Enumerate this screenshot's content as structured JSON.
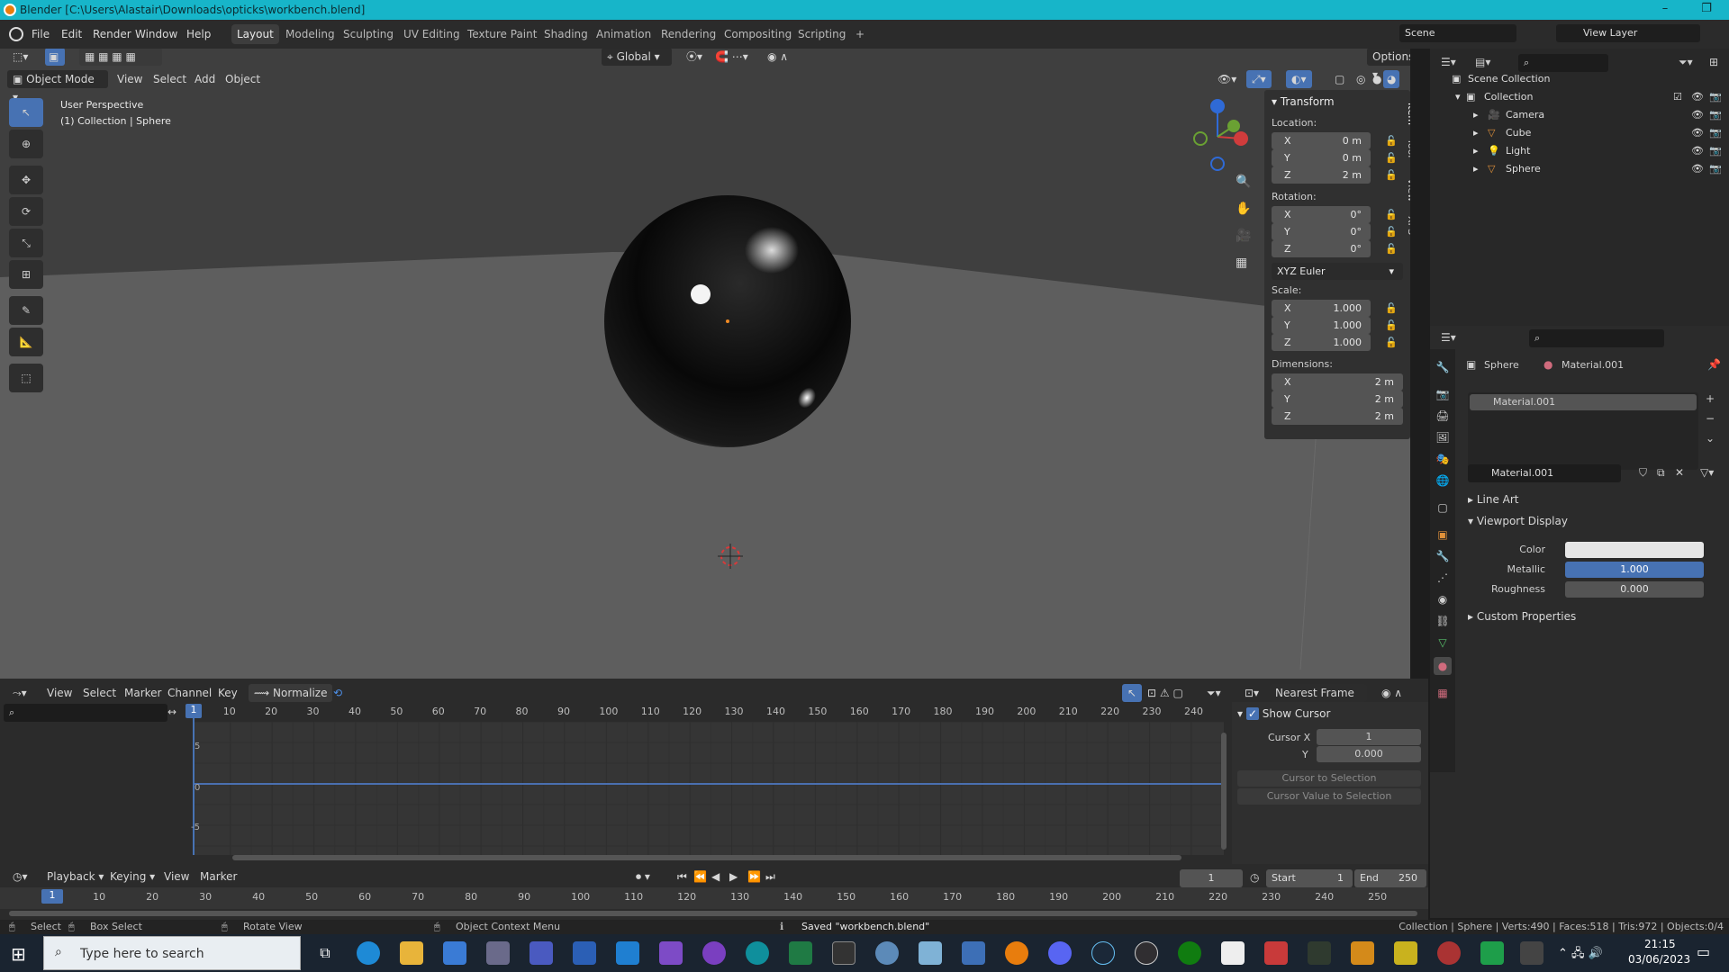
{
  "window": {
    "title": "Blender [C:\\Users\\Alastair\\Downloads\\opticks\\workbench.blend]"
  },
  "menu": {
    "items": [
      "File",
      "Edit",
      "Render",
      "Window",
      "Help"
    ]
  },
  "workspaces": [
    "Layout",
    "Modeling",
    "Sculpting",
    "UV Editing",
    "Texture Paint",
    "Shading",
    "Animation",
    "Rendering",
    "Compositing",
    "Scripting",
    "+"
  ],
  "scene": {
    "name": "Scene",
    "view_layer": "View Layer"
  },
  "viewport": {
    "transform_orientation": "Global",
    "mode": "Object Mode",
    "menus": [
      "View",
      "Select",
      "Add",
      "Object"
    ],
    "options_label": "Options",
    "perspective": "User Perspective",
    "collection_info": "(1) Collection | Sphere"
  },
  "npanel": {
    "title": "Transform",
    "tabs": [
      "Item",
      "Tool",
      "View",
      "XPS"
    ],
    "location_label": "Location:",
    "location": [
      {
        "axis": "X",
        "value": "0 m"
      },
      {
        "axis": "Y",
        "value": "0 m"
      },
      {
        "axis": "Z",
        "value": "2 m"
      }
    ],
    "rotation_label": "Rotation:",
    "rotation": [
      {
        "axis": "X",
        "value": "0°"
      },
      {
        "axis": "Y",
        "value": "0°"
      },
      {
        "axis": "Z",
        "value": "0°"
      }
    ],
    "rotation_mode": "XYZ Euler",
    "scale_label": "Scale:",
    "scale": [
      {
        "axis": "X",
        "value": "1.000"
      },
      {
        "axis": "Y",
        "value": "1.000"
      },
      {
        "axis": "Z",
        "value": "1.000"
      }
    ],
    "dimensions_label": "Dimensions:",
    "dimensions": [
      {
        "axis": "X",
        "value": "2 m"
      },
      {
        "axis": "Y",
        "value": "2 m"
      },
      {
        "axis": "Z",
        "value": "2 m"
      }
    ]
  },
  "outliner": {
    "root": "Scene Collection",
    "collection": "Collection",
    "objects": [
      "Camera",
      "Cube",
      "Light",
      "Sphere"
    ]
  },
  "properties": {
    "object": "Sphere",
    "material": "Material.001",
    "slot": "Material.001",
    "sections": {
      "line_art": "Line Art",
      "viewport_display": "Viewport Display",
      "custom_properties": "Custom Properties"
    },
    "color_label": "Color",
    "color_value": "#e6e6e6",
    "metallic_label": "Metallic",
    "metallic_value": "1.000",
    "roughness_label": "Roughness",
    "roughness_value": "0.000"
  },
  "graph": {
    "menus": [
      "View",
      "Select",
      "Marker",
      "Channel",
      "Key"
    ],
    "normalize": "Normalize",
    "snap": "Nearest Frame",
    "current_frame": "1",
    "ticks": [
      "10",
      "20",
      "30",
      "40",
      "50",
      "60",
      "70",
      "80",
      "90",
      "100",
      "110",
      "120",
      "130",
      "140",
      "150",
      "160",
      "170",
      "180",
      "190",
      "200",
      "210",
      "220",
      "230",
      "240"
    ],
    "y_labels": [
      "5",
      "0",
      "-5"
    ],
    "show_cursor": "Show Cursor",
    "cursor_x_label": "Cursor X",
    "cursor_x": "1",
    "cursor_y_label": "Y",
    "cursor_y": "0.000",
    "cursor_to_selection": "Cursor to Selection",
    "cursor_value_to_selection": "Cursor Value to Selection"
  },
  "timeline": {
    "menus": [
      "Playback",
      "Keying",
      "View",
      "Marker"
    ],
    "frame": "1",
    "start_label": "Start",
    "start": "1",
    "end_label": "End",
    "end": "250",
    "current": "1",
    "ticks": [
      "10",
      "20",
      "30",
      "40",
      "50",
      "60",
      "70",
      "80",
      "90",
      "100",
      "110",
      "120",
      "130",
      "140",
      "150",
      "160",
      "170",
      "180",
      "190",
      "200",
      "210",
      "220",
      "230",
      "240",
      "250"
    ]
  },
  "status": {
    "select": "Select",
    "box_select": "Box Select",
    "rotate_view": "Rotate View",
    "context_menu": "Object Context Menu",
    "saved": "Saved \"workbench.blend\"",
    "stats": "Collection | Sphere | Verts:490 | Faces:518 | Tris:972 | Objects:0/4"
  },
  "taskbar": {
    "search_placeholder": "Type here to search",
    "time": "21:15",
    "date": "03/06/2023"
  }
}
